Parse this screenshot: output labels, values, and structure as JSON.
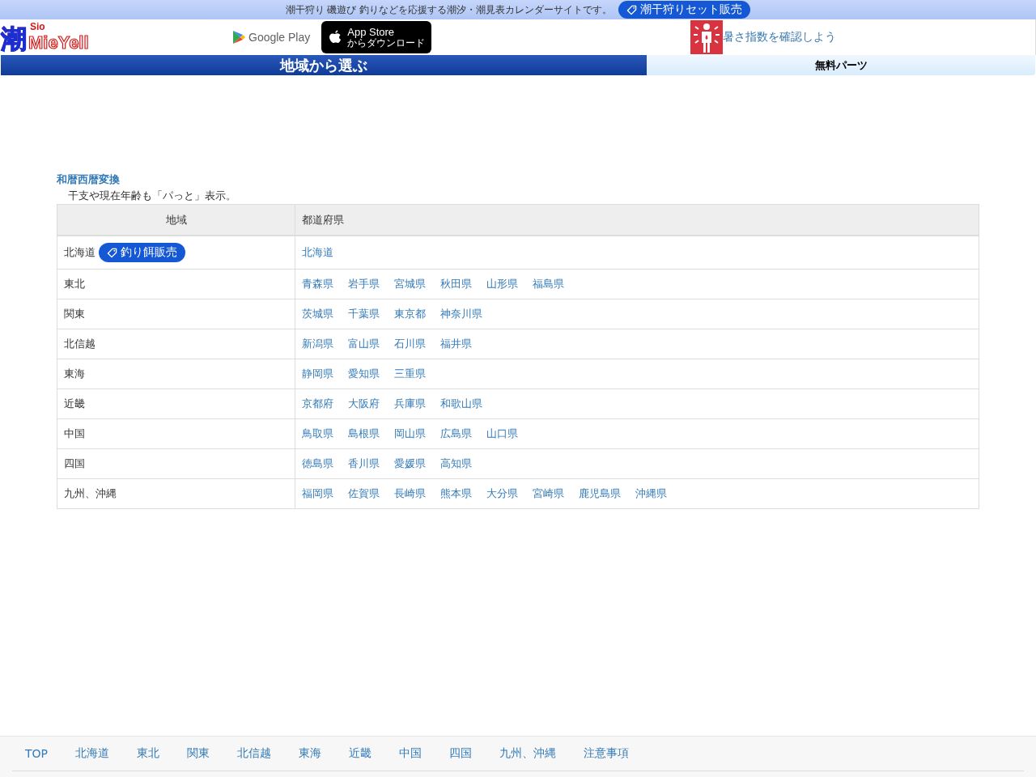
{
  "top_bar": {
    "tagline": "潮干狩り 磯遊び 釣りなどを応援する潮汐・潮見表カレンダーサイトです。",
    "badge": "潮干狩りセット販売"
  },
  "header": {
    "logo": {
      "kanji": "潮",
      "small": "Sio",
      "name": "MieYell"
    },
    "google_play": "Google Play",
    "app_store": {
      "title": "App Store",
      "subtitle": "からダウンロード"
    },
    "heat_link": "暑さ指数を確認しよう"
  },
  "tabs": [
    {
      "label": "地域から選ぶ",
      "selected": true
    },
    {
      "label": "無料パーツ",
      "selected": false
    }
  ],
  "notice": {
    "link": "和暦西暦変換",
    "text": "干支や現在年齢も「パっと」表示。"
  },
  "table": {
    "columns": [
      "地域",
      "都道府県"
    ],
    "rows": [
      {
        "region": "北海道",
        "badge": "釣り餌販売",
        "prefectures": [
          "北海道"
        ]
      },
      {
        "region": "東北",
        "prefectures": [
          "青森県",
          "岩手県",
          "宮城県",
          "秋田県",
          "山形県",
          "福島県"
        ]
      },
      {
        "region": "関東",
        "prefectures": [
          "茨城県",
          "千葉県",
          "東京都",
          "神奈川県"
        ]
      },
      {
        "region": "北信越",
        "prefectures": [
          "新潟県",
          "富山県",
          "石川県",
          "福井県"
        ]
      },
      {
        "region": "東海",
        "prefectures": [
          "静岡県",
          "愛知県",
          "三重県"
        ]
      },
      {
        "region": "近畿",
        "prefectures": [
          "京都府",
          "大阪府",
          "兵庫県",
          "和歌山県"
        ]
      },
      {
        "region": "中国",
        "prefectures": [
          "鳥取県",
          "島根県",
          "岡山県",
          "広島県",
          "山口県"
        ]
      },
      {
        "region": "四国",
        "prefectures": [
          "徳島県",
          "香川県",
          "愛媛県",
          "高知県"
        ]
      },
      {
        "region": "九州、沖縄",
        "prefectures": [
          "福岡県",
          "佐賀県",
          "長崎県",
          "熊本県",
          "大分県",
          "宮崎県",
          "鹿児島県",
          "沖縄県"
        ]
      }
    ]
  },
  "footer": {
    "links": [
      "TOP",
      "北海道",
      "東北",
      "関東",
      "北信越",
      "東海",
      "近畿",
      "中国",
      "四国",
      "九州、沖縄",
      "注意事項"
    ]
  }
}
